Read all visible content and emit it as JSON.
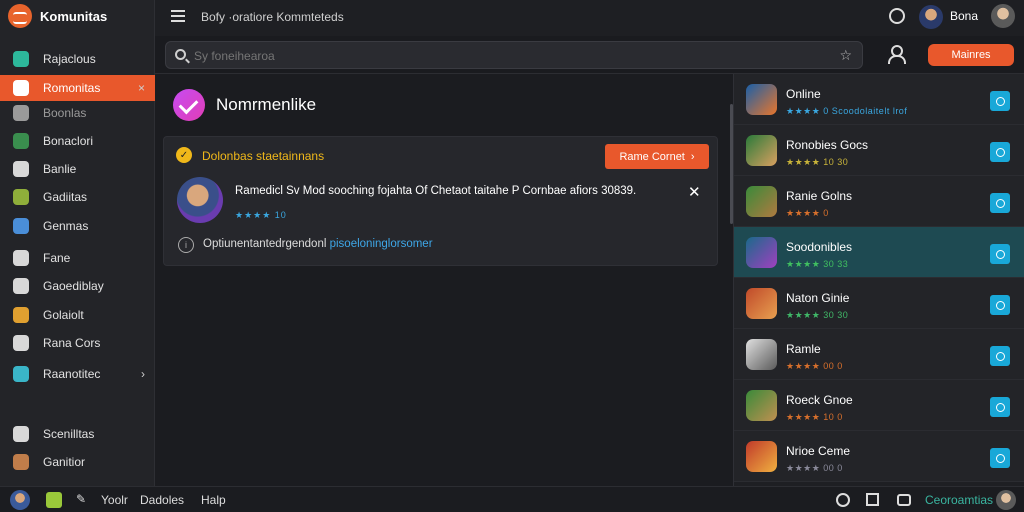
{
  "app": {
    "name": "Komunitas"
  },
  "sidebar": {
    "items": [
      {
        "label": "Rajaclous",
        "icon": "globe-icon",
        "color": "#2db89b"
      },
      {
        "label": "Romonitas",
        "icon": "pin-icon",
        "color": "#ffffff",
        "active": true,
        "trail": "×"
      },
      {
        "label": "Boonlas",
        "icon": "settings-icon",
        "color": "#9a9a9a",
        "dim": true
      },
      {
        "label": "Bonaclori",
        "icon": "chat-icon",
        "color": "#3a8e4e"
      },
      {
        "label": "Banlie",
        "icon": "bookmark-icon",
        "color": "#d8d8d8"
      },
      {
        "label": "Gadiitas",
        "icon": "game-icon",
        "color": "#8fae3a"
      },
      {
        "label": "Genmas",
        "icon": "controller-icon",
        "color": "#4a8ed8"
      },
      {
        "label": "Fane",
        "icon": "download-icon",
        "color": "#d8d8d8"
      },
      {
        "label": "Gaoediblay",
        "icon": "screen-icon",
        "color": "#d8d8d8"
      },
      {
        "label": "Golaiolt",
        "icon": "apps-icon",
        "color": "#e0a030"
      },
      {
        "label": "Rana Cors",
        "icon": "stack-icon",
        "color": "#d8d8d8"
      },
      {
        "label": "Raanotitec",
        "icon": "compass-icon",
        "color": "#3ab5c8",
        "trail": "›"
      },
      {
        "label": "Scenilltas",
        "icon": "circle-icon",
        "color": "#d8d8d8"
      },
      {
        "label": "Ganitior",
        "icon": "portrait-icon",
        "color": "#c07d4a"
      }
    ]
  },
  "topbar": {
    "breadcrumb": "Bofy ·oratiore Kommteteds",
    "username": "Bona"
  },
  "search": {
    "placeholder": "Sy foneihearoa"
  },
  "primary_button": "Mainres",
  "main": {
    "title": "Nomrmenlike",
    "card": {
      "title": "Dolonbas staetainnans",
      "button": "Rame Cornet",
      "notice": "Ramedicl Sv Mod sooching fojahta Of Chetaot taitahe P Cornbae afiors 30839.",
      "rating": "★★★★ 10",
      "footnote_prefix": "Optiunentantedrgendonl",
      "footnote_link": "pisoeloninglorsomer"
    }
  },
  "right_list": [
    {
      "name": "Online",
      "meta": "★★★★ 0 Scoodolaitelt lrof",
      "meta_color": "#3aa7e0",
      "thumb": [
        "#1a5fa8",
        "#e8762c"
      ]
    },
    {
      "name": "Ronobies Gocs",
      "meta": "★★★★ 10 30",
      "meta_color": "#c9b43a",
      "thumb": [
        "#2a7a3a",
        "#d9a060"
      ]
    },
    {
      "name": "Ranie Golns",
      "meta": "★★★★ 0",
      "meta_color": "#d8702c",
      "thumb": [
        "#3a8a3a",
        "#b07a40"
      ]
    },
    {
      "name": "Soodonibles",
      "meta": "★★★★ 30 33",
      "meta_color": "#40c060",
      "thumb": [
        "#1a6a8a",
        "#a040c0"
      ],
      "highlight": true
    },
    {
      "name": "Naton Ginie",
      "meta": "★★★★ 30 30",
      "meta_color": "#40b868",
      "thumb": [
        "#c04a2a",
        "#e8a050"
      ]
    },
    {
      "name": "Ramle",
      "meta": "★★★★ 00 0",
      "meta_color": "#d8702c",
      "thumb": [
        "#e0e0e0",
        "#5a5a5a"
      ]
    },
    {
      "name": "Roeck Gnoe",
      "meta": "★★★★ 10 0",
      "meta_color": "#d8702c",
      "thumb": [
        "#3a8a3a",
        "#c09050"
      ]
    },
    {
      "name": "Nrioe Ceme",
      "meta": "★★★★ 00 0",
      "meta_color": "#8a8a9a",
      "thumb": [
        "#c03a2a",
        "#f0b040"
      ]
    }
  ],
  "bottombar": {
    "items": [
      "Yoolr",
      "Dadoles",
      "Halp"
    ],
    "status": "Ceoroamtias",
    "status_color": "#3ab5a0"
  }
}
